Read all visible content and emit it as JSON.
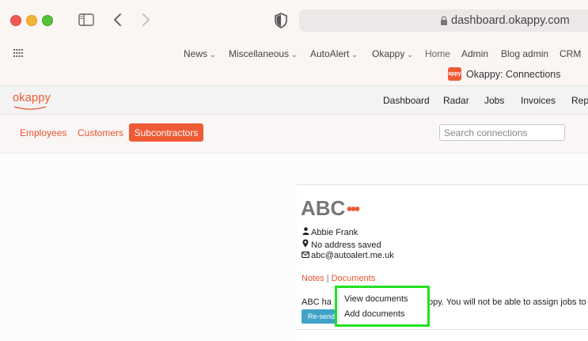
{
  "browser": {
    "url": "dashboard.okappy.com",
    "tab_title": "Okappy: Connections",
    "tab_favicon_text": "appy"
  },
  "bookmarks": [
    {
      "label": "News",
      "has_menu": true
    },
    {
      "label": "Miscellaneous",
      "has_menu": true
    },
    {
      "label": "AutoAlert",
      "has_menu": true
    },
    {
      "label": "Okappy",
      "has_menu": true
    },
    {
      "label": "Home",
      "has_menu": false
    },
    {
      "label": "Admin",
      "has_menu": false
    },
    {
      "label": "Blog admin",
      "has_menu": false
    },
    {
      "label": "CRM",
      "has_menu": false
    }
  ],
  "app": {
    "logo": "okappy",
    "brand_color": "#ee5a34",
    "nav": [
      "Dashboard",
      "Radar",
      "Jobs",
      "Invoices",
      "Repo"
    ]
  },
  "subnav": {
    "tabs": [
      "Employees",
      "Customers",
      "Subcontractors"
    ],
    "active": "Subcontractors",
    "search_placeholder": "Search connections"
  },
  "connection": {
    "name": "ABC",
    "more": "•••",
    "contact_name": "Abbie Frank",
    "address": "No address saved",
    "email": "abc@autoalert.me.uk",
    "links": [
      "Notes",
      "Documents"
    ],
    "notice_start": "ABC ha",
    "notice_end": "ppy. You will not be able to assign jobs to t",
    "resend_label": "Re-send"
  },
  "documents_menu": {
    "items": [
      "View documents",
      "Add documents"
    ],
    "highlight_color": "#22e022"
  }
}
